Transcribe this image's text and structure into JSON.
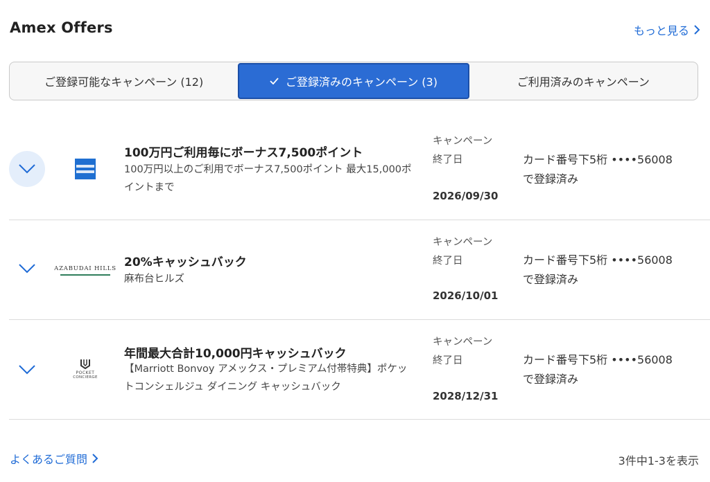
{
  "header": {
    "title": "Amex Offers",
    "more_label": "もっと見る"
  },
  "tabs": [
    {
      "label": "ご登録可能なキャンペーン (12)",
      "active": false
    },
    {
      "label": "ご登録済みのキャンペーン (3)",
      "active": true
    },
    {
      "label": "ご利用済みのキャンペーン",
      "active": false
    }
  ],
  "offers": [
    {
      "title": "100万円ご利用毎にボーナス7,500ポイント",
      "desc": "100万円以上のご利用でボーナス7,500ポイント 最大15,000ポイントまで",
      "end_label_1": "キャンペーン",
      "end_label_2": "終了日",
      "end_date": "2026/09/30",
      "enroll_1": "カード番号下5桁 ••••56008",
      "enroll_2": "で登録済み",
      "logo_text": "AMERICAN EXPRESS"
    },
    {
      "title": "20%キャッシュバック",
      "desc": "麻布台ヒルズ",
      "end_label_1": "キャンペーン",
      "end_label_2": "終了日",
      "end_date": "2026/10/01",
      "enroll_1": "カード番号下5桁 ••••56008",
      "enroll_2": "で登録済み",
      "logo_text": "AZABUDAI HILLS"
    },
    {
      "title": "年間最大合計10,000円キャッシュバック",
      "desc": "【Marriott Bonvoy アメックス・プレミアム付帯特典】ポケットコンシェルジュ ダイニング キャッシュバック",
      "end_label_1": "キャンペーン",
      "end_label_2": "終了日",
      "end_date": "2028/12/31",
      "enroll_1": "カード番号下5桁 ••••56008",
      "enroll_2": "で登録済み",
      "logo_text_1": "POCKET",
      "logo_text_2": "CONCIERGE"
    }
  ],
  "footer": {
    "faq_label": "よくあるご質問",
    "count_label": "3件中1-3を表示"
  },
  "colors": {
    "accent": "#2b6cd4",
    "link": "#1f6bd6"
  }
}
